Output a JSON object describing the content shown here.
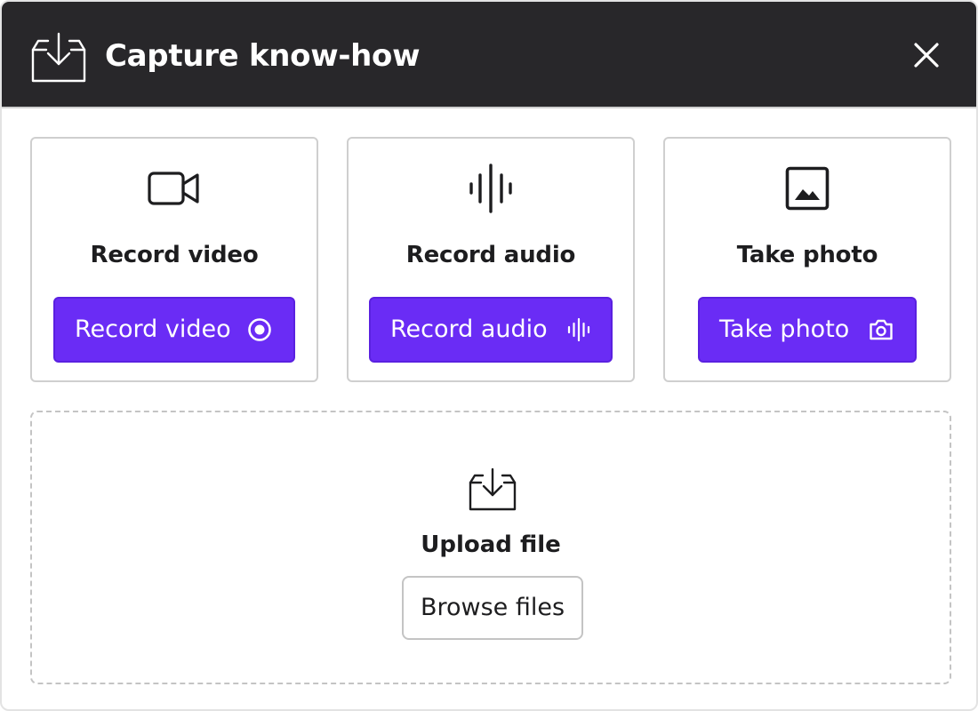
{
  "dialog": {
    "title": "Capture know-how",
    "header_icon": "tray-download-icon",
    "close_icon": "close-icon"
  },
  "options": [
    {
      "title": "Record video",
      "icon": "video-camera-icon",
      "button_label": "Record video",
      "button_icon": "record-icon"
    },
    {
      "title": "Record audio",
      "icon": "audio-waveform-icon",
      "button_label": "Record audio",
      "button_icon": "waveform-icon"
    },
    {
      "title": "Take photo",
      "icon": "image-icon",
      "button_label": "Take photo",
      "button_icon": "camera-icon"
    }
  ],
  "upload": {
    "title": "Upload file",
    "icon": "tray-download-icon",
    "button_label": "Browse files"
  },
  "colors": {
    "header_bg": "#28272a",
    "primary": "#6a2cf5",
    "border": "#cfcfcf"
  }
}
